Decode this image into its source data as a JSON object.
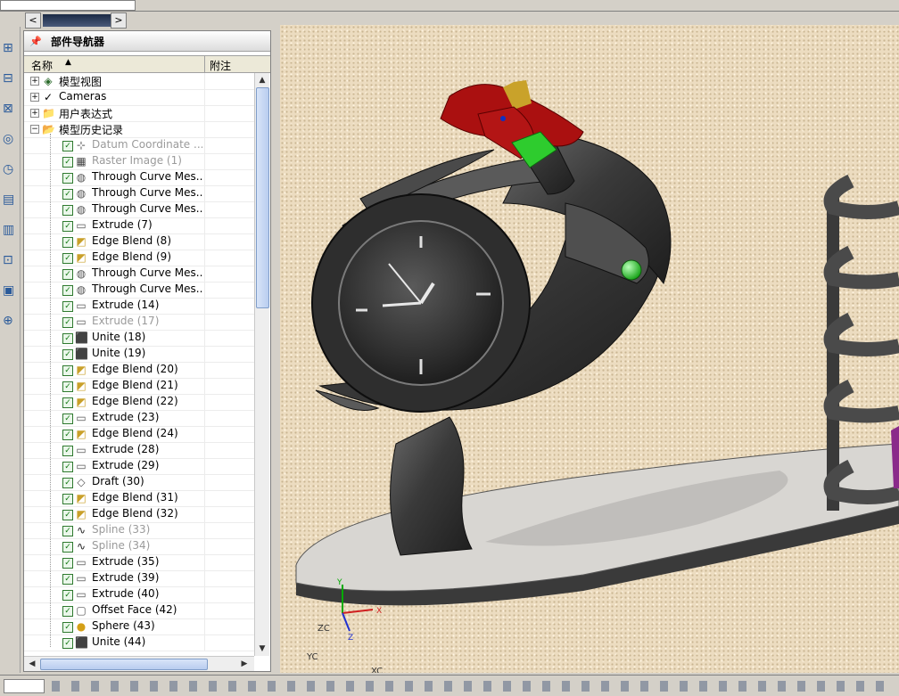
{
  "panel": {
    "title": "部件导航器",
    "col_name": "名称",
    "col_note": "附注"
  },
  "tree": {
    "top_items": [
      {
        "label": "模型视图",
        "icon": "model-views-icon"
      },
      {
        "label": "Cameras",
        "icon": "cameras-icon"
      },
      {
        "label": "用户表达式",
        "icon": "folder-icon"
      },
      {
        "label": "模型历史记录",
        "icon": "folder-open-icon"
      }
    ],
    "features": [
      {
        "label": "Datum Coordinate ...",
        "icon": "datum-csys-icon",
        "dim": true
      },
      {
        "label": "Raster Image (1)",
        "icon": "raster-image-icon",
        "dim": true
      },
      {
        "label": "Through Curve Mes...",
        "icon": "through-curve-mesh-icon",
        "dim": false
      },
      {
        "label": "Through Curve Mes...",
        "icon": "through-curve-mesh-icon",
        "dim": false
      },
      {
        "label": "Through Curve Mes...",
        "icon": "through-curve-mesh-icon",
        "dim": false
      },
      {
        "label": "Extrude (7)",
        "icon": "extrude-icon",
        "dim": false
      },
      {
        "label": "Edge Blend (8)",
        "icon": "edge-blend-icon",
        "dim": false
      },
      {
        "label": "Edge Blend (9)",
        "icon": "edge-blend-icon",
        "dim": false
      },
      {
        "label": "Through Curve Mes...",
        "icon": "through-curve-mesh-icon",
        "dim": false
      },
      {
        "label": "Through Curve Mes...",
        "icon": "through-curve-mesh-icon",
        "dim": false
      },
      {
        "label": "Extrude (14)",
        "icon": "extrude-icon",
        "dim": false
      },
      {
        "label": "Extrude (17)",
        "icon": "extrude-icon",
        "dim": true
      },
      {
        "label": "Unite (18)",
        "icon": "unite-icon",
        "dim": false
      },
      {
        "label": "Unite (19)",
        "icon": "unite-icon",
        "dim": false
      },
      {
        "label": "Edge Blend (20)",
        "icon": "edge-blend-icon",
        "dim": false
      },
      {
        "label": "Edge Blend (21)",
        "icon": "edge-blend-icon",
        "dim": false
      },
      {
        "label": "Edge Blend (22)",
        "icon": "edge-blend-icon",
        "dim": false
      },
      {
        "label": "Extrude (23)",
        "icon": "extrude-icon",
        "dim": false
      },
      {
        "label": "Edge Blend (24)",
        "icon": "edge-blend-icon",
        "dim": false
      },
      {
        "label": "Extrude (28)",
        "icon": "extrude-icon",
        "dim": false
      },
      {
        "label": "Extrude (29)",
        "icon": "extrude-icon",
        "dim": false
      },
      {
        "label": "Draft (30)",
        "icon": "draft-icon",
        "dim": false
      },
      {
        "label": "Edge Blend (31)",
        "icon": "edge-blend-icon",
        "dim": false
      },
      {
        "label": "Edge Blend (32)",
        "icon": "edge-blend-icon",
        "dim": false
      },
      {
        "label": "Spline (33)",
        "icon": "spline-icon",
        "dim": true
      },
      {
        "label": "Spline (34)",
        "icon": "spline-icon",
        "dim": true
      },
      {
        "label": "Extrude (35)",
        "icon": "extrude-icon",
        "dim": false
      },
      {
        "label": "Extrude (39)",
        "icon": "extrude-icon",
        "dim": false
      },
      {
        "label": "Extrude (40)",
        "icon": "extrude-icon",
        "dim": false
      },
      {
        "label": "Offset Face (42)",
        "icon": "offset-face-icon",
        "dim": false
      },
      {
        "label": "Sphere (43)",
        "icon": "sphere-icon",
        "dim": false
      },
      {
        "label": "Unite (44)",
        "icon": "unite-icon",
        "dim": false
      }
    ]
  },
  "viewport": {
    "axis_x": "X",
    "axis_y": "Y",
    "axis_z": "Z",
    "label_zc": "ZC",
    "label_yc": "YC",
    "label_xc": "XC"
  },
  "colors": {
    "viewport_bg": "#ecdcc0",
    "model_body": "#3c3c3c",
    "base_plate": "#d8d6d2",
    "accent_red": "#aa1010",
    "accent_green": "#2ecc2e",
    "check_green": "#157a15"
  }
}
